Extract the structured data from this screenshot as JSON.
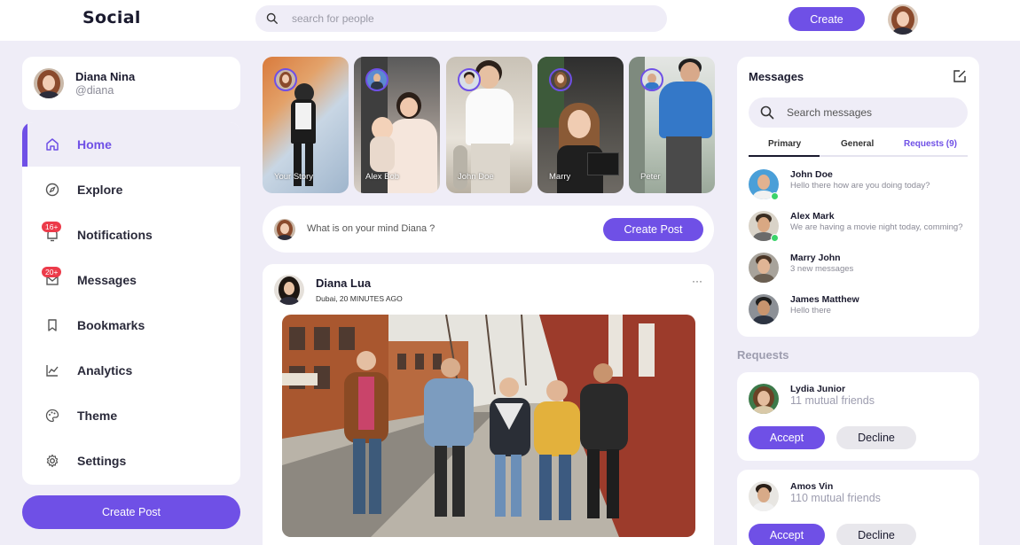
{
  "app": {
    "logo": "Social"
  },
  "topbar": {
    "search_placeholder": "search for people",
    "create_label": "Create"
  },
  "profile": {
    "name": "Diana Nina",
    "handle": "@diana"
  },
  "sidebar": {
    "items": [
      {
        "label": "Home",
        "icon": "home-icon",
        "active": true
      },
      {
        "label": "Explore",
        "icon": "compass-icon"
      },
      {
        "label": "Notifications",
        "icon": "bell-icon",
        "badge": "16+"
      },
      {
        "label": "Messages",
        "icon": "envelope-icon",
        "badge": "20+"
      },
      {
        "label": "Bookmarks",
        "icon": "bookmark-icon"
      },
      {
        "label": "Analytics",
        "icon": "chart-line-icon"
      },
      {
        "label": "Theme",
        "icon": "palette-icon"
      },
      {
        "label": "Settings",
        "icon": "gear-icon"
      }
    ],
    "create_post_label": "Create Post"
  },
  "stories": [
    {
      "name": "Your Story"
    },
    {
      "name": "Alex Bob"
    },
    {
      "name": "John Doe"
    },
    {
      "name": "Marry"
    },
    {
      "name": "Peter"
    }
  ],
  "composer": {
    "placeholder": "What is on your mind Diana ?",
    "button_label": "Create Post"
  },
  "feed": {
    "author": "Diana Lua",
    "meta": "Dubai, 20 MINUTES AGO",
    "more": "···"
  },
  "messages": {
    "title": "Messages",
    "search_placeholder": "Search messages",
    "tabs": [
      "Primary",
      "General",
      "Requests (9)"
    ],
    "items": [
      {
        "name": "John Doe",
        "text": "Hello there how are you doing today?",
        "online": true
      },
      {
        "name": "Alex Mark",
        "text": "We are having a movie night today, comming?",
        "online": true
      },
      {
        "name": "Marry John",
        "text": "3 new messages",
        "online": false
      },
      {
        "name": "James Matthew",
        "text": "Hello there",
        "online": false
      }
    ]
  },
  "requests": {
    "heading": "Requests",
    "items": [
      {
        "name": "Lydia Junior",
        "mutual": "11 mutual friends",
        "accept": "Accept",
        "decline": "Decline"
      },
      {
        "name": "Amos Vin",
        "mutual": "110 mutual friends",
        "accept": "Accept",
        "decline": "Decline"
      }
    ]
  },
  "colors": {
    "accent": "#6f50e6",
    "background": "#efedf7",
    "badge": "#ec3b4a",
    "online": "#3bd36a"
  }
}
